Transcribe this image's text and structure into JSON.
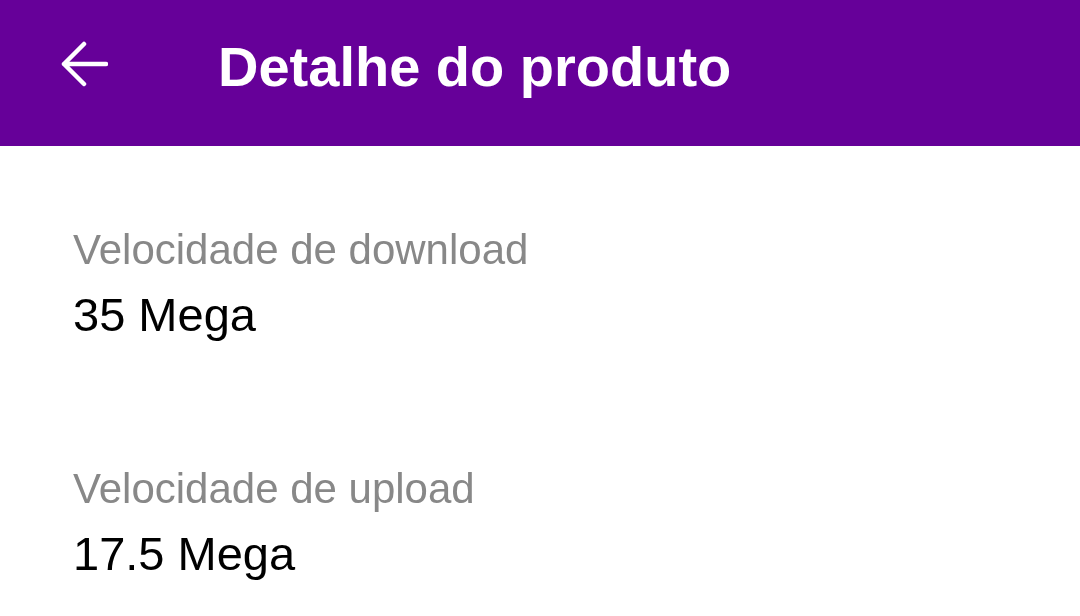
{
  "app_bar": {
    "title": "Detalhe do produto"
  },
  "details": [
    {
      "label": "Velocidade de download",
      "value": "35 Mega"
    },
    {
      "label": "Velocidade de upload",
      "value": "17.5 Mega"
    }
  ]
}
